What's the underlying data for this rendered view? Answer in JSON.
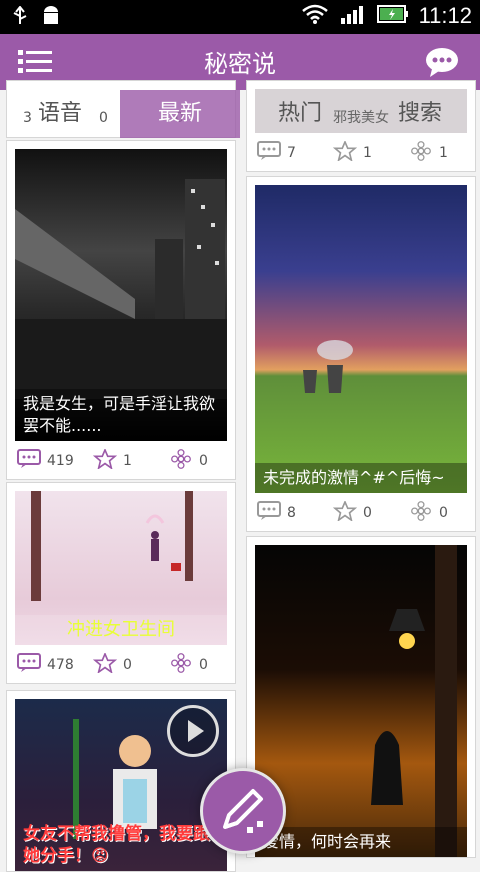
{
  "status_bar": {
    "time": "11:12"
  },
  "app_bar": {
    "title": "秘密说"
  },
  "tabs": [
    {
      "label": "语音"
    },
    {
      "label": "最新"
    },
    {
      "label": "热门"
    },
    {
      "label": "搜索"
    }
  ],
  "left_column": {
    "top_partial_stats": {
      "comments": "3",
      "likes": "0",
      "flowers": "0"
    },
    "cards": [
      {
        "caption": "我是女生，可是手淫让我欲罢不能......",
        "comments": "419",
        "likes": "1",
        "flowers": "0"
      },
      {
        "caption": "冲进女卫生间",
        "comments": "478",
        "likes": "0",
        "flowers": "0"
      },
      {
        "caption": "女友不帮我撸管，我要跟她分手！😡"
      }
    ]
  },
  "right_column": {
    "top_partial_caption": "邪我美女",
    "top_partial_stats": {
      "comments": "7",
      "likes": "1",
      "flowers": "1"
    },
    "cards": [
      {
        "caption": "未完成的激情^#^后悔~",
        "comments": "8",
        "likes": "0",
        "flowers": "0"
      },
      {
        "caption": "爱情，何时会再来"
      }
    ]
  },
  "colors": {
    "accent": "#9b5aa8",
    "statusbar": "#000000"
  },
  "icons": [
    "usb-icon",
    "android-debug-icon",
    "wifi-icon",
    "signal-icon",
    "battery-icon",
    "menu-icon",
    "chat-icon",
    "comment-icon",
    "star-icon",
    "flower-icon",
    "play-icon",
    "compose-pencil-icon"
  ]
}
